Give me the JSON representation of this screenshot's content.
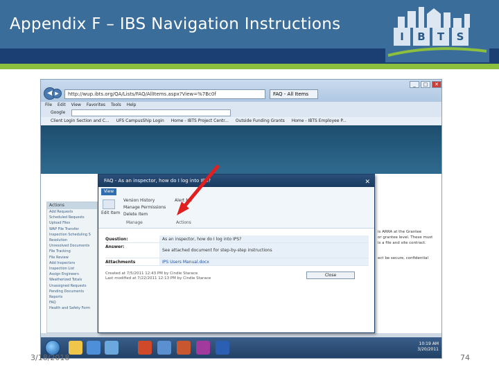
{
  "slide": {
    "title": "Appendix F – IBS Navigation Instructions",
    "logo_letters": [
      "I",
      "B",
      "T",
      "S"
    ],
    "footer_date": "3/18/2018",
    "page_number": "74"
  },
  "browser": {
    "address": "http://wup.ibts.org/QA/Lists/FAQ/AllItems.aspx?View=%7Bc0f",
    "tab_title": "FAQ - All Items",
    "menu": [
      "File",
      "Edit",
      "View",
      "Favorites",
      "Tools",
      "Help"
    ],
    "search_label": "Google",
    "favorites": [
      "Client Login Section and C...",
      "UFS CampusShip Login",
      "Home - IBTS Project Centr...",
      "Outside Funding Grants",
      "Home - IBTS Employee P..."
    ]
  },
  "left_nav": {
    "heading": "Actions",
    "items": [
      "Add Requests",
      "Scheduled Requests",
      "Upload Files",
      "WAP File Transfer",
      "Inspection Scheduling S",
      "Resolution",
      "Unresolved Documents",
      "File Tracking",
      "File Review",
      "Add Inspectors",
      "Inspection List",
      "Assign Engineers",
      "Weatherized Totals",
      "Unassigned Requests",
      "Pending Documents",
      "Reports",
      "FAQ",
      "Health and Safety Form"
    ]
  },
  "dialog": {
    "title": "FAQ - As an inspector, how do I log into IPS?",
    "ribbon_tab": "View",
    "ribbon_items": [
      "Version History",
      "Manage Permissions",
      "Delete Item",
      "Alert Me"
    ],
    "edit_label": "Edit Item",
    "group_manage": "Manage",
    "group_actions": "Actions",
    "rows": [
      {
        "label": "Question:",
        "value": "As an inspector, how do I log into IPS?"
      },
      {
        "label": "Answer:",
        "value": "See attached document for step-by-step instructions"
      },
      {
        "label": "Attachments",
        "value": "IPS Users Manual.docx"
      }
    ],
    "meta_created": "Created at 7/5/2011 12:43 PM by Cindie Starace",
    "meta_modified": "Last modified at 7/22/2011 12:13 PM by Cindie Starace",
    "close_label": "Close"
  },
  "right_text": [
    "is ARRA at the Grantee",
    "or grantee level. These must",
    "is a file and site contract.",
    "ect be secure, confidential"
  ],
  "taskbar": {
    "time": "10:19 AM",
    "date": "3/20/2011"
  },
  "colors": {
    "header_blue": "#3b6d9b",
    "band_dark": "#1b3f73",
    "band_green": "#8dbf3f",
    "arrow_red": "#e02020"
  }
}
